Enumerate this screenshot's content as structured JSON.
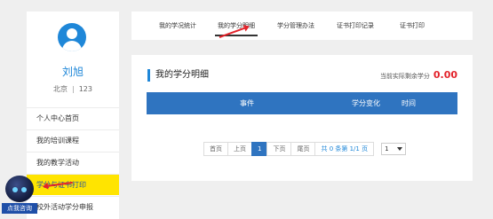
{
  "user": {
    "name": "刘旭",
    "city": "北京",
    "separator": "|",
    "id": "123"
  },
  "sidebar": {
    "items": [
      {
        "label": "个人中心首页"
      },
      {
        "label": "我的培训课程"
      },
      {
        "label": "我的教学活动"
      },
      {
        "label": "学分与证书打印"
      },
      {
        "label": "校外活动学分申报"
      }
    ],
    "active_index": 3
  },
  "tabs": [
    {
      "label": "我的学况统计"
    },
    {
      "label": "我的学分明细"
    },
    {
      "label": "学分管理办法"
    },
    {
      "label": "证书打印记录"
    },
    {
      "label": "证书打印"
    }
  ],
  "active_tab": 1,
  "main": {
    "title": "我的学分明细",
    "balance_label": "当前实际剩余学分",
    "balance_value": "0.00",
    "columns": [
      "事件",
      "学分变化",
      "时间"
    ]
  },
  "pagination": {
    "first": "首页",
    "prev": "上页",
    "current": "1",
    "next": "下页",
    "last": "尾页",
    "info": "共 0 条第 1/1 页",
    "select_value": "1"
  },
  "helper": {
    "label": "点我咨询"
  },
  "colors": {
    "accent": "#1f87d8",
    "header_blue": "#2f74c0",
    "highlight": "#ffe400",
    "alert": "#e3232b"
  }
}
